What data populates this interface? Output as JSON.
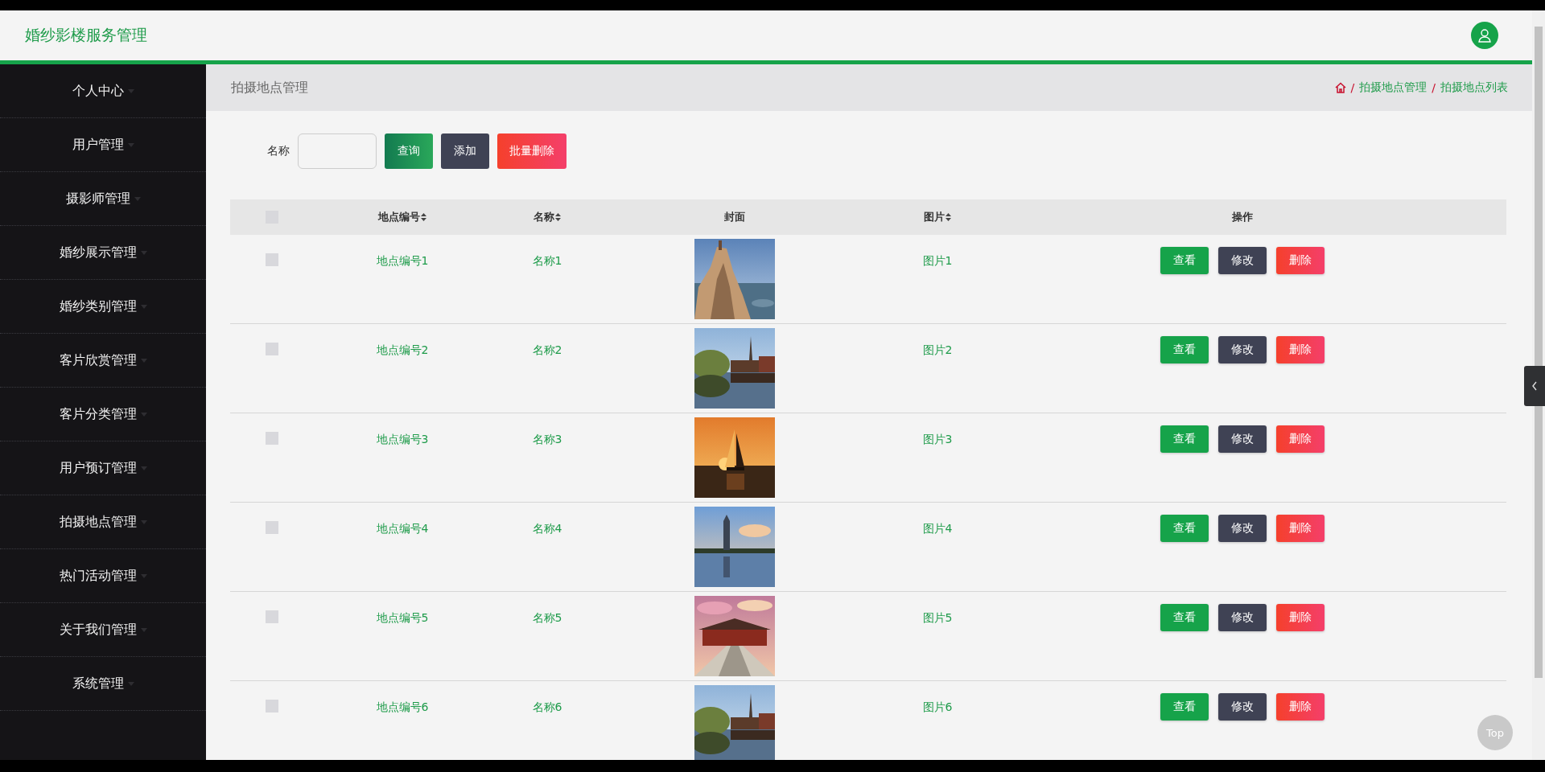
{
  "header": {
    "title": "婚纱影楼服务管理"
  },
  "sidebar": {
    "items": [
      {
        "label": "个人中心",
        "selected": false
      },
      {
        "label": "用户管理",
        "selected": false
      },
      {
        "label": "摄影师管理",
        "selected": false
      },
      {
        "label": "婚纱展示管理",
        "selected": false
      },
      {
        "label": "婚纱类别管理",
        "selected": false
      },
      {
        "label": "客片欣赏管理",
        "selected": false
      },
      {
        "label": "客片分类管理",
        "selected": false
      },
      {
        "label": "用户预订管理",
        "selected": false
      },
      {
        "label": "拍摄地点管理",
        "selected": false
      },
      {
        "label": "热门活动管理",
        "selected": false
      },
      {
        "label": "关于我们管理",
        "selected": false
      },
      {
        "label": "系统管理",
        "selected": false
      }
    ]
  },
  "page_title": "拍摄地点管理",
  "breadcrumb": [
    {
      "separator": "/",
      "label": "拍摄地点管理"
    },
    {
      "separator": "/",
      "label": "拍摄地点列表"
    }
  ],
  "search": {
    "label": "名称",
    "buttons": [
      {
        "label": "查询",
        "kind": "search"
      },
      {
        "label": "添加",
        "kind": "add"
      },
      {
        "label": "批量删除",
        "kind": "delete"
      }
    ]
  },
  "table": {
    "select_all": {
      "checked": false
    },
    "columns": [
      {
        "label": "地点编号",
        "sortable": true
      },
      {
        "label": "名称",
        "sortable": true
      },
      {
        "label": "封面",
        "sortable": false
      },
      {
        "label": "图片",
        "sortable": true
      },
      {
        "label": "操作",
        "sortable": false
      }
    ],
    "rows": [
      {
        "checked": false,
        "code": "地点编号1",
        "name": "名称1",
        "image": "图片1",
        "actions": [
          "查看",
          "修改",
          "删除"
        ]
      },
      {
        "checked": false,
        "code": "地点编号2",
        "name": "名称2",
        "image": "图片2",
        "actions": [
          "查看",
          "修改",
          "删除"
        ]
      },
      {
        "checked": false,
        "code": "地点编号3",
        "name": "名称3",
        "image": "图片3",
        "actions": [
          "查看",
          "修改",
          "删除"
        ]
      },
      {
        "checked": false,
        "code": "地点编号4",
        "name": "名称4",
        "image": "图片4",
        "actions": [
          "查看",
          "修改",
          "删除"
        ]
      },
      {
        "checked": false,
        "code": "地点编号5",
        "name": "名称5",
        "image": "图片5",
        "actions": [
          "查看",
          "修改",
          "删除"
        ]
      },
      {
        "checked": false,
        "code": "地点编号6",
        "name": "名称6",
        "image": "图片6",
        "actions": [
          "查看",
          "修改",
          "删除"
        ]
      }
    ]
  },
  "back_to_top": "Top"
}
